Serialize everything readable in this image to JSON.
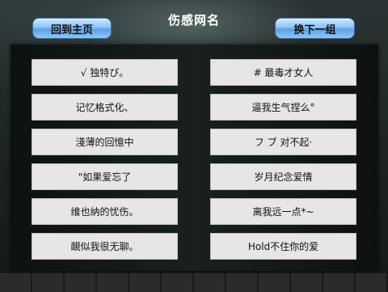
{
  "header": {
    "title": "伤感网名",
    "home_label": "回到主页",
    "next_label": "换下一组"
  },
  "names": [
    "√ 独特ぴ。",
    "# 最毒才女人",
    "记忆格式化、",
    "逼我生气捏么°",
    "淺薄的回憶中",
    "フ ブ 对不起·",
    "\"如果爱忘了",
    "岁月纪念爱情",
    "维也纳的忧伤。",
    "离我远一点*~",
    "靦似我很无聊。",
    "Hold不住你的爱"
  ]
}
